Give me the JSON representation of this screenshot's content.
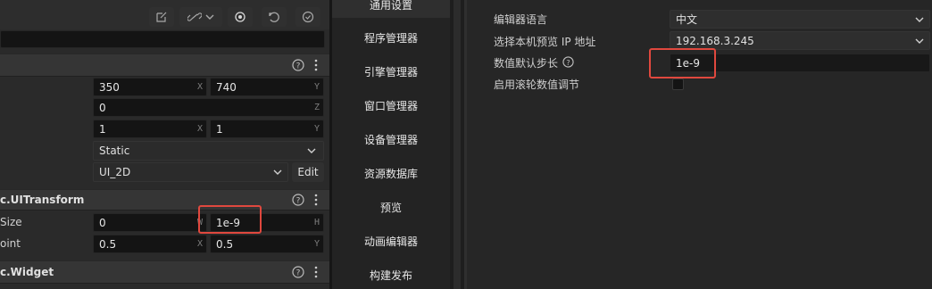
{
  "inspector": {
    "name_value": "",
    "sections": [
      {
        "title": ""
      },
      {
        "title": "c.UITransform"
      },
      {
        "title": "c.Widget"
      }
    ],
    "node": {
      "position": {
        "x": "350",
        "x_axis": "X",
        "y": "740",
        "y_axis": "Y"
      },
      "rotation": {
        "z": "0",
        "z_axis": "Z"
      },
      "scale": {
        "x": "1",
        "x_axis": "X",
        "y": "1",
        "y_axis": "Y"
      },
      "mobility": "Static",
      "layer": "UI_2D",
      "edit_label": "Edit"
    },
    "ui_transform": {
      "content_size_label": "Size",
      "width": "0",
      "width_axis": "W",
      "height": "1e-9",
      "height_axis": "H",
      "anchor_point_label": "oint",
      "anchor_x": "0.5",
      "anchor_x_axis": "X",
      "anchor_y": "0.5",
      "anchor_y_axis": "Y"
    }
  },
  "nav": {
    "items": [
      {
        "label": "通用设置"
      },
      {
        "label": "程序管理器"
      },
      {
        "label": "引擎管理器"
      },
      {
        "label": "窗口管理器"
      },
      {
        "label": "设备管理器"
      },
      {
        "label": "资源数据库"
      },
      {
        "label": "预览"
      },
      {
        "label": "动画编辑器"
      },
      {
        "label": "构建发布"
      }
    ]
  },
  "settings": {
    "editor_language": {
      "label": "编辑器语言",
      "value": "中文"
    },
    "preview_ip": {
      "label": "选择本机预览 IP 地址",
      "value": "192.168.3.245"
    },
    "default_step": {
      "label": "数值默认步长",
      "value": "1e-9"
    },
    "wheel_adjust": {
      "label": "启用滚轮数值调节",
      "checked": false
    }
  },
  "colors": {
    "highlight_box": "#e0483e",
    "accent": "#3b8eea"
  }
}
